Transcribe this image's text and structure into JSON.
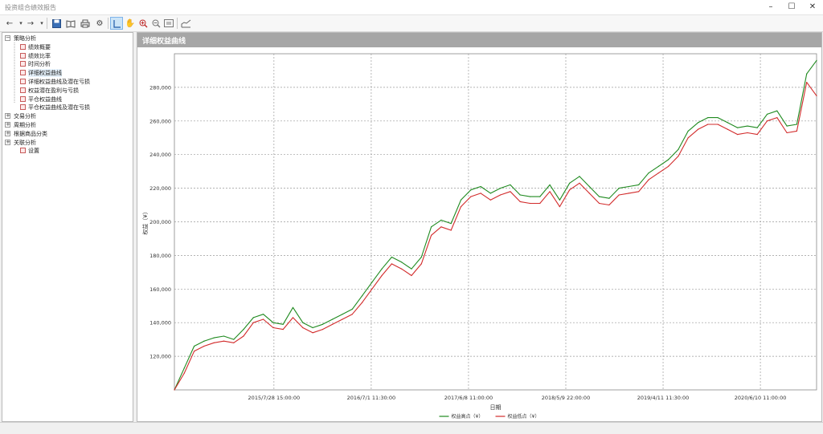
{
  "window": {
    "title": "投资组合绩效报告",
    "min_icon": "minimize-icon",
    "max_icon": "maximize-icon",
    "close_icon": "close-icon"
  },
  "toolbar": {
    "buttons": [
      "back-arrow-icon",
      "forward-arrow-icon",
      "save-icon",
      "open-book-icon",
      "print-icon",
      "gear-icon",
      "pointer-select-icon",
      "hand-pan-icon",
      "zoom-in-icon",
      "zoom-out-icon",
      "fit-window-icon",
      "speed-chart-icon"
    ],
    "active": "pointer-select-icon"
  },
  "tree": {
    "nodes": [
      {
        "label": "策略分析",
        "level": 0,
        "expander": "−"
      },
      {
        "label": "绩效概要",
        "level": 1
      },
      {
        "label": "绩效比率",
        "level": 1
      },
      {
        "label": "时间分析",
        "level": 1
      },
      {
        "label": "详细权益曲线",
        "level": 1,
        "selected": true
      },
      {
        "label": "详细权益曲线及潜在亏损",
        "level": 1
      },
      {
        "label": "权益潜在盈利与亏损",
        "level": 1
      },
      {
        "label": "平仓权益曲线",
        "level": 1
      },
      {
        "label": "平仓权益曲线及潜在亏损",
        "level": 1
      },
      {
        "label": "交易分析",
        "level": 0,
        "expander": "+"
      },
      {
        "label": "周期分析",
        "level": 0,
        "expander": "+"
      },
      {
        "label": "根据商品分类",
        "level": 0,
        "expander": "+"
      },
      {
        "label": "关联分析",
        "level": 0,
        "expander": "+"
      },
      {
        "label": "设置",
        "level": 1
      }
    ]
  },
  "panel": {
    "title": "详细权益曲线"
  },
  "chart_data": {
    "type": "line",
    "title": "",
    "xlabel": "日期",
    "ylabel": "权益（¥）",
    "ylim": [
      100000,
      300000
    ],
    "yticks": [
      120000,
      140000,
      160000,
      180000,
      200000,
      220000,
      240000,
      260000,
      280000
    ],
    "ytick_labels": [
      "120,000",
      "140,000",
      "160,000",
      "180,000",
      "200,000",
      "220,000",
      "240,000",
      "260,000",
      "280,000"
    ],
    "x_tick_labels": [
      "2015/7/28 15:00:00",
      "2016/7/1 11:30:00",
      "2017/6/8 11:00:00",
      "2018/5/9 22:00:00",
      "2019/4/11 11:30:00",
      "2020/6/10 11:00:00"
    ],
    "grid": true,
    "legend_position": "bottom-center",
    "series": [
      {
        "name": "权益高点（¥）",
        "color": "#1f8a1f",
        "x": [
          0,
          1,
          2,
          3,
          4,
          5,
          6,
          7,
          8,
          9,
          10,
          11,
          12,
          13,
          14,
          15,
          16,
          17,
          18,
          19,
          20,
          21,
          22,
          23,
          24,
          25,
          26,
          27,
          28,
          29,
          30,
          31,
          32,
          33,
          34,
          35,
          36,
          37,
          38,
          39,
          40,
          41,
          42,
          43,
          44,
          45,
          46,
          47,
          48,
          49,
          50,
          51,
          52,
          53,
          54,
          55,
          56,
          57,
          58,
          59,
          60,
          61,
          62,
          63,
          64,
          65
        ],
        "values": [
          100000,
          113000,
          126000,
          129000,
          131000,
          132000,
          130000,
          136000,
          143000,
          145000,
          140000,
          139000,
          149000,
          140000,
          137000,
          139000,
          142000,
          145000,
          148000,
          156000,
          164000,
          172000,
          179000,
          176000,
          172000,
          179000,
          197000,
          201000,
          199000,
          213000,
          219000,
          221000,
          217000,
          220000,
          222000,
          216000,
          215000,
          215000,
          222000,
          213000,
          223000,
          227000,
          221000,
          215000,
          214000,
          220000,
          221000,
          222000,
          229000,
          233000,
          237000,
          243000,
          254000,
          259000,
          262000,
          262000,
          259000,
          256000,
          257000,
          256000,
          264000,
          266000,
          257000,
          258000,
          288000,
          296000
        ]
      },
      {
        "name": "权益低点（¥）",
        "color": "#d22b2b",
        "x": [
          0,
          1,
          2,
          3,
          4,
          5,
          6,
          7,
          8,
          9,
          10,
          11,
          12,
          13,
          14,
          15,
          16,
          17,
          18,
          19,
          20,
          21,
          22,
          23,
          24,
          25,
          26,
          27,
          28,
          29,
          30,
          31,
          32,
          33,
          34,
          35,
          36,
          37,
          38,
          39,
          40,
          41,
          42,
          43,
          44,
          45,
          46,
          47,
          48,
          49,
          50,
          51,
          52,
          53,
          54,
          55,
          56,
          57,
          58,
          59,
          60,
          61,
          62,
          63,
          64,
          65
        ],
        "values": [
          100000,
          110000,
          123000,
          126000,
          128000,
          129000,
          128000,
          132000,
          140000,
          142000,
          137000,
          136000,
          143000,
          137000,
          134000,
          136000,
          139000,
          142000,
          145000,
          152000,
          160000,
          168000,
          175000,
          172000,
          168000,
          175000,
          192000,
          197000,
          195000,
          209000,
          215000,
          217000,
          213000,
          216000,
          218000,
          212000,
          211000,
          211000,
          218000,
          209000,
          219000,
          223000,
          217000,
          211000,
          210000,
          216000,
          217000,
          218000,
          225000,
          229000,
          233000,
          239000,
          250000,
          255000,
          258000,
          258000,
          255000,
          252000,
          253000,
          252000,
          260000,
          262000,
          253000,
          254000,
          283000,
          275000
        ]
      }
    ]
  }
}
